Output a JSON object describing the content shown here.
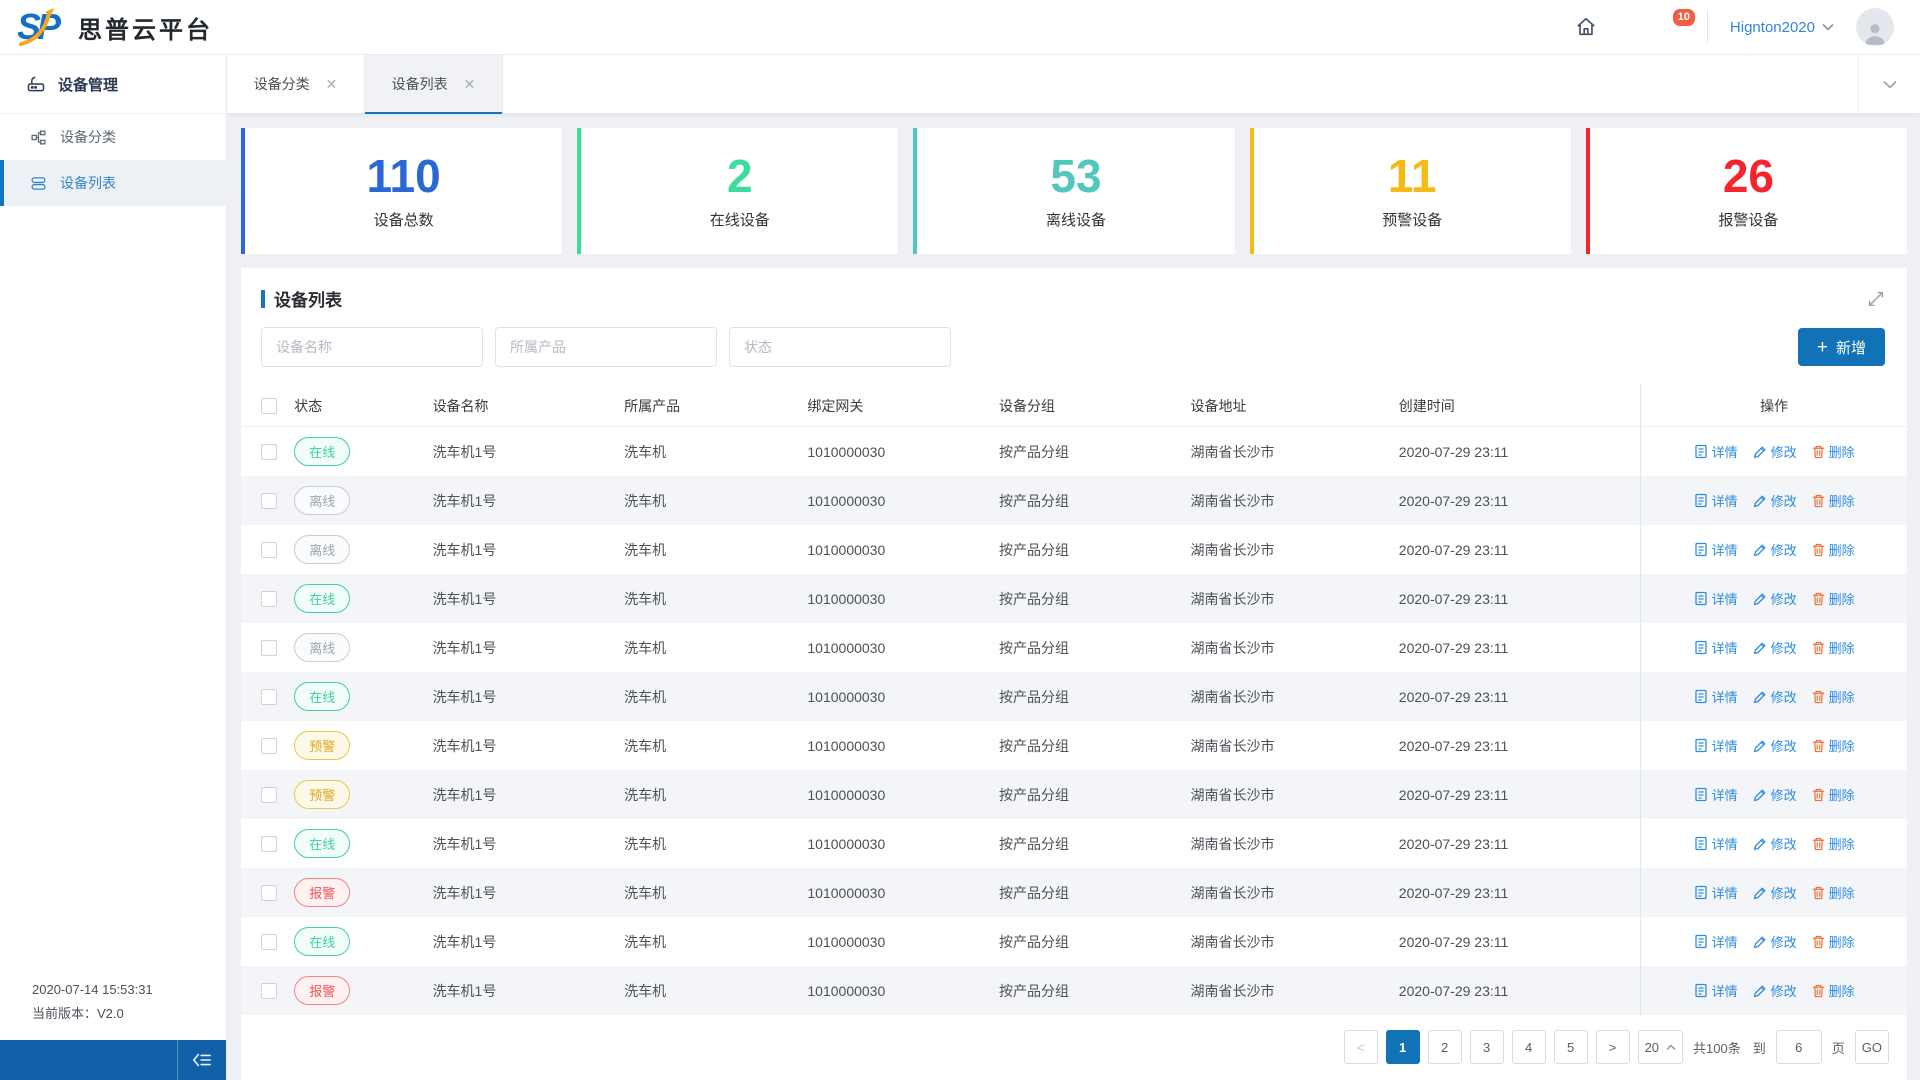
{
  "header": {
    "logo_text": "SP",
    "brand": "思普云平台",
    "username": "Hignton2020",
    "notification_count": "10"
  },
  "sidebar": {
    "title": "设备管理",
    "items": [
      {
        "label": "设备分类",
        "active": false
      },
      {
        "label": "设备列表",
        "active": true
      }
    ],
    "footer": {
      "time": "2020-07-14 15:53:31",
      "version": "当前版本：V2.0"
    }
  },
  "tabs": [
    {
      "label": "设备分类",
      "active": false
    },
    {
      "label": "设备列表",
      "active": true
    }
  ],
  "stats": [
    {
      "value": "110",
      "label": "设备总数",
      "color": "#2c68d5"
    },
    {
      "value": "2",
      "label": "在线设备",
      "color": "#3edc9c"
    },
    {
      "value": "53",
      "label": "离线设备",
      "color": "#52c7be"
    },
    {
      "value": "11",
      "label": "预警设备",
      "color": "#f2bb16"
    },
    {
      "value": "26",
      "label": "报警设备",
      "color": "#f5242d"
    }
  ],
  "panel": {
    "title": "设备列表",
    "filters": [
      {
        "placeholder": "设备名称"
      },
      {
        "placeholder": "所属产品"
      },
      {
        "placeholder": "状态"
      }
    ],
    "add_button": "新增"
  },
  "table": {
    "columns": [
      "状态",
      "设备名称",
      "所属产品",
      "绑定网关",
      "设备分组",
      "设备地址",
      "创建时间",
      "操作"
    ],
    "row_actions": [
      {
        "label": "详情",
        "icon": "detail-icon"
      },
      {
        "label": "修改",
        "icon": "edit-icon"
      },
      {
        "label": "删除",
        "icon": "delete-icon"
      }
    ],
    "status_colors": {
      "online": "#42d29d",
      "offline": "#a0a6b0",
      "warning": "#dcaa1e",
      "alarm": "#f25555"
    },
    "rows": [
      {
        "status": "在线",
        "status_type": "online",
        "name": "洗车机1号",
        "product": "洗车机",
        "gateway": "1010000030",
        "group": "按产品分组",
        "address": "湖南省长沙市",
        "created": "2020-07-29 23:11"
      },
      {
        "status": "离线",
        "status_type": "offline",
        "name": "洗车机1号",
        "product": "洗车机",
        "gateway": "1010000030",
        "group": "按产品分组",
        "address": "湖南省长沙市",
        "created": "2020-07-29 23:11"
      },
      {
        "status": "离线",
        "status_type": "offline",
        "name": "洗车机1号",
        "product": "洗车机",
        "gateway": "1010000030",
        "group": "按产品分组",
        "address": "湖南省长沙市",
        "created": "2020-07-29 23:11"
      },
      {
        "status": "在线",
        "status_type": "online",
        "name": "洗车机1号",
        "product": "洗车机",
        "gateway": "1010000030",
        "group": "按产品分组",
        "address": "湖南省长沙市",
        "created": "2020-07-29 23:11"
      },
      {
        "status": "离线",
        "status_type": "offline",
        "name": "洗车机1号",
        "product": "洗车机",
        "gateway": "1010000030",
        "group": "按产品分组",
        "address": "湖南省长沙市",
        "created": "2020-07-29 23:11"
      },
      {
        "status": "在线",
        "status_type": "online",
        "name": "洗车机1号",
        "product": "洗车机",
        "gateway": "1010000030",
        "group": "按产品分组",
        "address": "湖南省长沙市",
        "created": "2020-07-29 23:11"
      },
      {
        "status": "预警",
        "status_type": "warning",
        "name": "洗车机1号",
        "product": "洗车机",
        "gateway": "1010000030",
        "group": "按产品分组",
        "address": "湖南省长沙市",
        "created": "2020-07-29 23:11"
      },
      {
        "status": "预警",
        "status_type": "warning",
        "name": "洗车机1号",
        "product": "洗车机",
        "gateway": "1010000030",
        "group": "按产品分组",
        "address": "湖南省长沙市",
        "created": "2020-07-29 23:11"
      },
      {
        "status": "在线",
        "status_type": "online",
        "name": "洗车机1号",
        "product": "洗车机",
        "gateway": "1010000030",
        "group": "按产品分组",
        "address": "湖南省长沙市",
        "created": "2020-07-29 23:11"
      },
      {
        "status": "报警",
        "status_type": "alarm",
        "name": "洗车机1号",
        "product": "洗车机",
        "gateway": "1010000030",
        "group": "按产品分组",
        "address": "湖南省长沙市",
        "created": "2020-07-29 23:11"
      },
      {
        "status": "在线",
        "status_type": "online",
        "name": "洗车机1号",
        "product": "洗车机",
        "gateway": "1010000030",
        "group": "按产品分组",
        "address": "湖南省长沙市",
        "created": "2020-07-29 23:11"
      },
      {
        "status": "报警",
        "status_type": "alarm",
        "name": "洗车机1号",
        "product": "洗车机",
        "gateway": "1010000030",
        "group": "按产品分组",
        "address": "湖南省长沙市",
        "created": "2020-07-29 23:11"
      }
    ]
  },
  "pagination": {
    "prev": "<",
    "pages": [
      "1",
      "2",
      "3",
      "4",
      "5"
    ],
    "active_page": "1",
    "next": ">",
    "page_size": "20",
    "total_text": "共100条",
    "to_label": "到",
    "jump_value": "6",
    "page_label": "页",
    "go_label": "GO"
  },
  "colors": {
    "primary_blue": "#1172b8",
    "tab_accent": "#1673c2",
    "link_blue": "#2e8ce0",
    "sidebar_bar_blue": "#1061a8"
  }
}
